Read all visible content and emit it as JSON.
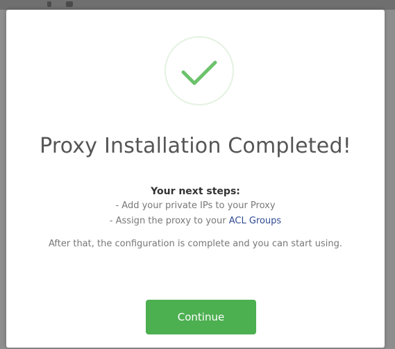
{
  "modal": {
    "icon": "checkmark-icon",
    "title": "Proxy Installation Completed!",
    "steps_heading": "Your next steps:",
    "step_1": "- Add your private IPs to your Proxy",
    "step_2_prefix": "- Assign the proxy to your ",
    "step_2_link": "ACL Groups",
    "after_text": "After that, the configuration is complete and you can start using.",
    "continue_label": "Continue"
  },
  "colors": {
    "accent_green": "#4caf50",
    "check_green": "#6cc26c",
    "circle_border": "#e4f2e1",
    "title_text": "#555555",
    "link": "#2f4a8f"
  }
}
